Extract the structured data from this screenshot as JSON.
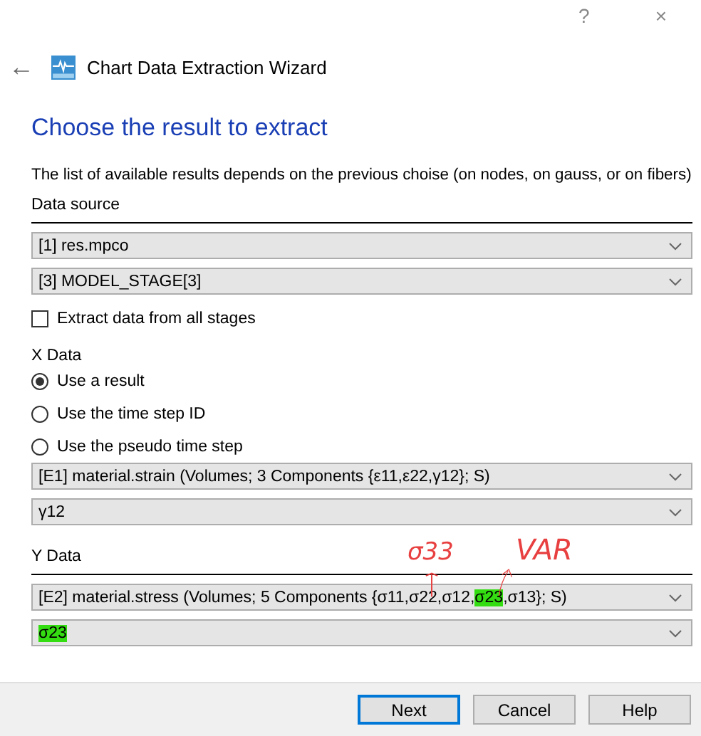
{
  "window": {
    "help": "?",
    "close": "×"
  },
  "header": {
    "back": "←",
    "title": "Chart Data Extraction Wizard"
  },
  "heading": "Choose the result to extract",
  "description": "The list of available results depends on the previous choise (on nodes, on gauss, or on fibers)",
  "data_source": {
    "label": "Data source",
    "combos": [
      {
        "parts": [
          {
            "text": "[1] res.mpco",
            "highlight": false
          }
        ]
      },
      {
        "parts": [
          {
            "text": "[3] MODEL_STAGE[3]",
            "highlight": false
          }
        ]
      }
    ],
    "checkbox": {
      "label": "Extract data from all stages",
      "checked": false
    }
  },
  "x_data": {
    "label": "X Data",
    "radios": [
      {
        "label": "Use a result",
        "selected": true
      },
      {
        "label": "Use the time step ID",
        "selected": false
      },
      {
        "label": "Use the pseudo time step",
        "selected": false
      }
    ],
    "combos": [
      {
        "parts": [
          {
            "text": "[E1] material.strain (Volumes; 3 Components {ε11,ε22,γ12}; S)",
            "highlight": false
          }
        ]
      },
      {
        "parts": [
          {
            "text": "γ12",
            "highlight": false
          }
        ]
      }
    ]
  },
  "y_data": {
    "label": "Y Data",
    "combos": [
      {
        "parts": [
          {
            "text": "[E2] material.stress (Volumes; 5 Components {σ11,σ22,σ12,",
            "highlight": false
          },
          {
            "text": "σ23",
            "highlight": true
          },
          {
            "text": ",σ13}; S)",
            "highlight": false
          }
        ]
      },
      {
        "parts": [
          {
            "text": "σ23",
            "highlight": true
          }
        ]
      }
    ]
  },
  "annotations": [
    {
      "text": "σ33"
    },
    {
      "text": "VAR"
    }
  ],
  "buttons": [
    {
      "label": "Next",
      "default": true
    },
    {
      "label": "Cancel",
      "default": false
    },
    {
      "label": "Help",
      "default": false
    }
  ]
}
